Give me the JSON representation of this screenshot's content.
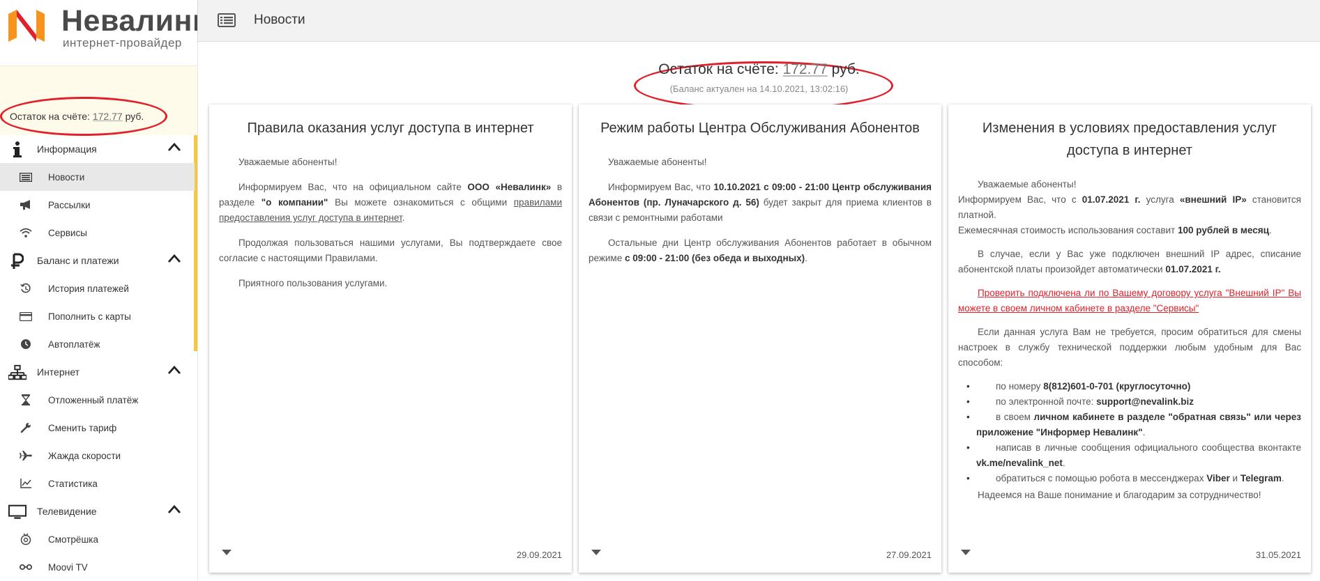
{
  "brand": {
    "name": "Невалинк",
    "tagline": "интернет-провайдер",
    "colors": {
      "logo_orange": "#f7941d",
      "logo_red": "#e0202a",
      "highlight": "#e0202a",
      "scroll": "#f5c842"
    }
  },
  "sidebar": {
    "balance_prefix": "Остаток на счёте:",
    "balance_amount": "172.77",
    "balance_suffix": "руб.",
    "groups": [
      {
        "label": "Информация",
        "icon": "info-icon",
        "items": [
          {
            "label": "Новости",
            "icon": "news-icon",
            "active": true
          },
          {
            "label": "Рассылки",
            "icon": "megaphone-icon"
          },
          {
            "label": "Сервисы",
            "icon": "wifi-icon"
          }
        ]
      },
      {
        "label": "Баланс и платежи",
        "icon": "ruble-icon",
        "items": [
          {
            "label": "История платежей",
            "icon": "history-icon"
          },
          {
            "label": "Пополнить с карты",
            "icon": "credit-card-icon"
          },
          {
            "label": "Автоплатёж",
            "icon": "clock-icon"
          }
        ]
      },
      {
        "label": "Интернет",
        "icon": "network-icon",
        "items": [
          {
            "label": "Отложенный платёж",
            "icon": "hourglass-icon"
          },
          {
            "label": "Сменить тариф",
            "icon": "wrench-icon"
          },
          {
            "label": "Жажда скорости",
            "icon": "airplane-icon"
          },
          {
            "label": "Статистика",
            "icon": "stats-icon"
          }
        ]
      },
      {
        "label": "Телевидение",
        "icon": "tv-icon",
        "items": [
          {
            "label": "Смотрёшка",
            "icon": "smotreshka-icon"
          },
          {
            "label": "Moovi TV",
            "icon": "glasses-icon"
          }
        ]
      }
    ]
  },
  "header": {
    "title": "Новости",
    "menu_icon": "list-icon"
  },
  "main": {
    "balance_prefix": "Остаток на счёте:",
    "balance_amount": "172.77",
    "balance_suffix": "руб.",
    "balance_note": "(Баланс актуален на 14.10.2021, 13:02:16)"
  },
  "cards": [
    {
      "title": "Правила оказания услуг доступа в интернет",
      "date": "29.09.2021",
      "p1": "Уважаемые абоненты!",
      "p2a": "Информируем Вас, что на официальном сайте",
      "p2b": "ООО «Невалинк»",
      "p2c": "в разделе",
      "p2d": "\"о компании\"",
      "p2e": "Вы можете ознакомиться с общими",
      "p2f": "правилами предоставления услуг доступа в интернет",
      "p2g": ".",
      "p3": "Продолжая пользоваться нашими услугами, Вы подтверждаете свое согласие с настоящими Правилами.",
      "p4": "Приятного пользования услугами."
    },
    {
      "title": "Режим работы Центра Обслуживания Абонентов",
      "date": "27.09.2021",
      "p1": "Уважаемые абоненты!",
      "p2a": "Информируем Вас, что",
      "p2b": "10.10.2021 с 09:00 - 21:00 Центр обслуживания Абонентов (пр. Луначарского д. 56)",
      "p2c": "будет закрыт для приема клиентов  в связи с ремонтными работами",
      "p3a": "Остальные дни Центр обслуживания Абонентов работает в обычном режиме",
      "p3b": "с 09:00 - 21:00 (без обеда и выходных)",
      "p3c": "."
    },
    {
      "title": "Изменения в условиях предоставления услуг доступа в интернет",
      "date": "31.05.2021",
      "p1": "Уважаемые абоненты!",
      "p2a": "Информируем Вас, что с",
      "p2b": "01.07.2021 г.",
      "p2c": "услуга",
      "p2d": "«внешний IP»",
      "p2e": "становится платной.",
      "p3a": "Ежемесячная стоимость использования составит",
      "p3b": "100 рублей в месяц",
      "p3c": ".",
      "p4a": "В случае, если у Вас уже подключен внешний IP адрес, списание абонентской платы произойдет автоматически",
      "p4b": "01.07.2021 г.",
      "link": "Проверить подключена ли по Вашему договору услуга \"Внешний IP\" Вы можете в своем личном кабинете в разделе \"Сервисы\"",
      "p5": "Если данная услуга Вам не требуется, просим обратиться для смены настроек в службу технической поддержки любым удобным для Вас способом:",
      "li1a": "по номеру",
      "li1b": "8(812)601-0-701 (круглосуточно)",
      "li2a": "по электронной почте:",
      "li2b": "support@nevalink.biz",
      "li3a": "в своем",
      "li3b": "личном кабинете в разделе \"обратная связь\" или через приложение \"Информер Невалинк\"",
      "li3c": ".",
      "li4a": "написав в личные сообщения официального сообщества вконтакте",
      "li4b": "vk.me/nevalink_net",
      "li4c": ".",
      "li5a": "обратиться с помощью робота в мессенджерах",
      "li5b": "Viber",
      "li5c": "и",
      "li5d": "Telegram",
      "li5e": ".",
      "closing": "Надеемся на Ваше понимание и благодарим за сотрудничество!"
    }
  ]
}
